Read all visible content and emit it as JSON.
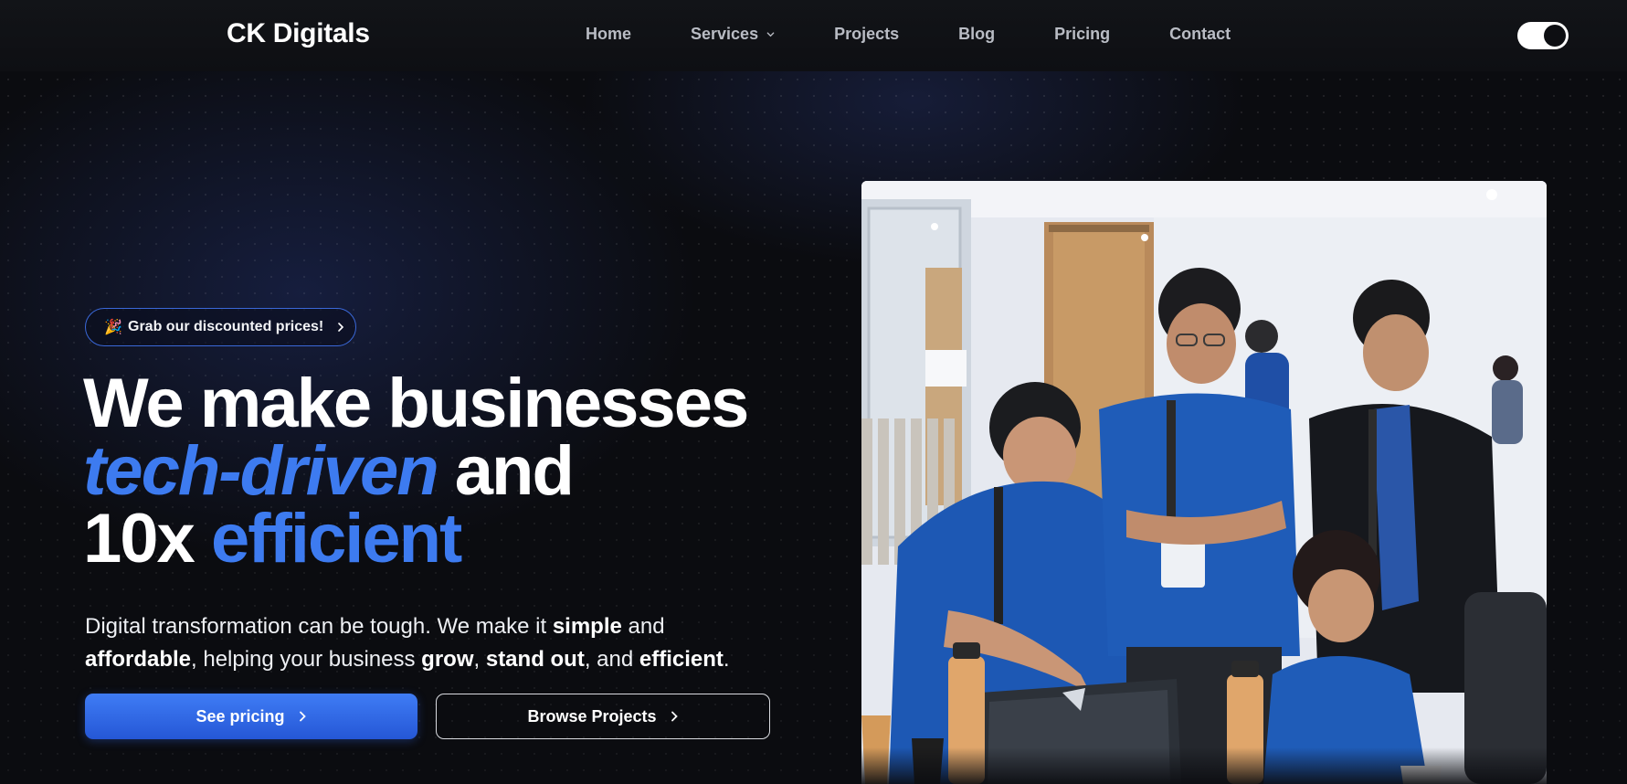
{
  "brand": {
    "name": "CK Digitals"
  },
  "nav": {
    "items": [
      {
        "label": "Home"
      },
      {
        "label": "Services",
        "has_dropdown": true
      },
      {
        "label": "Projects"
      },
      {
        "label": "Blog"
      },
      {
        "label": "Pricing"
      },
      {
        "label": "Contact"
      }
    ],
    "theme_toggle": {
      "state": "dark"
    }
  },
  "hero": {
    "promo": {
      "emoji": "🎉",
      "text": "Grab our discounted prices!"
    },
    "headline": {
      "line1": "We make businesses",
      "line2_highlight": "tech-driven",
      "line2_rest": "and",
      "line3_prefix": "10x",
      "line3_highlight": "efficient"
    },
    "description": {
      "p1": "Digital transformation can be tough. We make it ",
      "b1": "simple",
      "p2": " and ",
      "b2": "affordable",
      "p3": ", helping your business ",
      "b3": "grow",
      "p4": ", ",
      "b4": "stand out",
      "p5": ", and ",
      "b5": "efficient",
      "p6": "."
    },
    "buttons": {
      "primary": "See pricing",
      "secondary": "Browse Projects"
    },
    "image": {
      "subject": "team of people in blue t-shirts looking at a laptop"
    }
  },
  "colors": {
    "accent": "#3d7bf0",
    "background": "#0b0c10",
    "primary_button": "#2f68e6"
  }
}
